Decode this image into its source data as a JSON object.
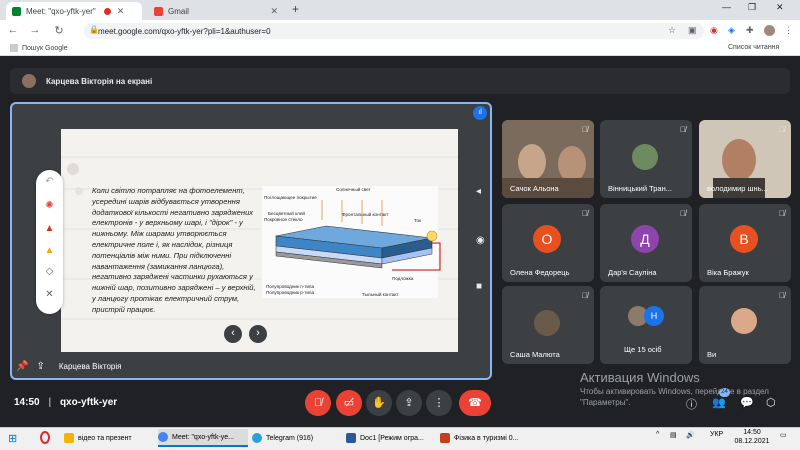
{
  "browser": {
    "tabs": [
      {
        "title": "Meet: \"qxo-yftk-yer\"",
        "active": true,
        "recording": true
      },
      {
        "title": "Gmail",
        "active": false
      }
    ],
    "new_tab": "+",
    "address": "meet.google.com/qxo-yftk-yer?pli=1&authuser=0",
    "bookmarks": {
      "left": "Пошук Google",
      "right": "Список читання"
    }
  },
  "meet": {
    "presenter_banner": "Карцева Вікторія на екрані",
    "slide_text": "Коли світло потрапляє на фотоелемент, усередині шарів відбувається утворення додаткової кількості негативно заряджених електронів - у верхньому шарі, і \"дірок\" - у нижньому. Між шарами утворюється електричне поле і, як наслідок, різниця потенціалів між ними. При підключенні навантаження (замикання ланцюга), негативно заряджені частинки рухаються у нижній шар, позитивно заряджені – у верхній, у ланцюгу протікає електричний струм, пристрій працює.",
    "diagram_labels": {
      "sun": "Солнечный свет",
      "absorb": "Поглощающее покрытие",
      "ar_glass": "Бесцветный клей",
      "cover_glass": "Покровное стекло",
      "front_contact": "Фронтальный контакт",
      "current": "Ток",
      "n_semi": "Полупроводник n-типа",
      "p_semi": "Полупроводник p-типа",
      "substrate": "Подложка",
      "back_contact": "Тыльный контакт"
    },
    "presenter_footer": "Карцева Вікторія",
    "participants": [
      {
        "name": "Сачок Альона",
        "type": "video"
      },
      {
        "name": "Вінницький Тран...",
        "type": "avatar"
      },
      {
        "name": "володимир шнь...",
        "type": "video"
      },
      {
        "name": "Олена Федорець",
        "type": "letter",
        "letter": "О",
        "color": "#e8501f"
      },
      {
        "name": "Дар'я Сауліна",
        "type": "letter",
        "letter": "Д",
        "color": "#8e44ad"
      },
      {
        "name": "Віка Бражук",
        "type": "letter",
        "letter": "В",
        "color": "#e8501f"
      },
      {
        "name": "Саша Малюта",
        "type": "avatar"
      },
      {
        "name": "Ще 15 осіб",
        "type": "more",
        "letter": "Н"
      },
      {
        "name": "Ви",
        "type": "avatar"
      }
    ],
    "time": "14:50",
    "meeting_code": "qxo-yftk-yer",
    "people_count": "24"
  },
  "activation": {
    "title": "Активация Windows",
    "subtitle": "Чтобы активировать Windows, перейдите в раздел \"Параметры\"."
  },
  "taskbar": {
    "items": [
      {
        "label": "відео та презент",
        "color": "#f4b400"
      },
      {
        "label": "Meet: \"qxo-yftk-ye...",
        "color": "#4285f4"
      },
      {
        "label": "Telegram (916)",
        "color": "#2aa1da"
      },
      {
        "label": "Doc1 [Режим огра...",
        "color": "#2b579a"
      },
      {
        "label": "Фізика в туризмі 0...",
        "color": "#c43e1c"
      }
    ],
    "lang": "УКР",
    "clock": "14:50",
    "date": "08.12.2021"
  },
  "colors": {
    "accent": "#8ab4f8",
    "end_call": "#ea4335",
    "meet_bg": "#202124"
  }
}
